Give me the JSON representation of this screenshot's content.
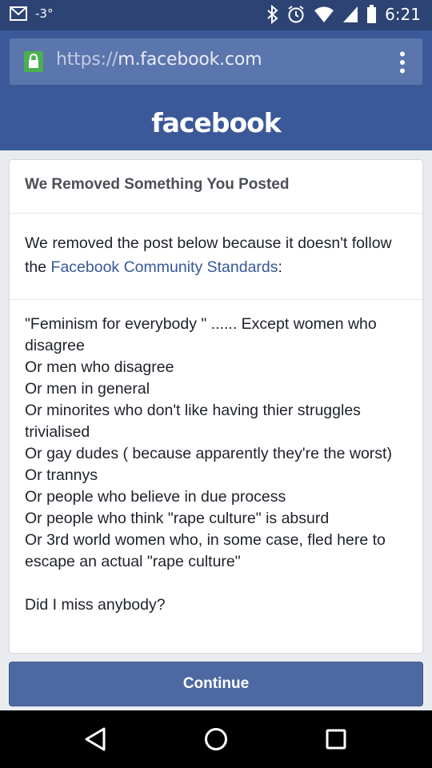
{
  "status_bar": {
    "temperature": "-3°",
    "time": "6:21",
    "icons": [
      "gmail-icon",
      "bluetooth-icon",
      "alarm-icon",
      "wifi-icon",
      "signal-icon",
      "battery-icon"
    ]
  },
  "browser": {
    "url_scheme": "https://",
    "url_host": "m.facebook.com",
    "icons": [
      "lock-icon",
      "overflow-menu-icon"
    ]
  },
  "header": {
    "logo_text": "facebook"
  },
  "card": {
    "title": "We Removed Something You Posted",
    "intro_text": "We removed the post below because it doesn't follow the ",
    "intro_link": "Facebook Community Standards",
    "intro_suffix": ":",
    "post_lines": [
      "\"Feminism for everybody \" ...... Except women who disagree",
      "Or men who disagree",
      "Or men in general",
      "Or minorites who don't like having thier struggles trivialised",
      "Or gay dudes ( because apparently they're the worst)",
      "Or trannys",
      "Or people who believe in due process",
      "Or people who think \"rape culture\" is absurd",
      "Or 3rd world women who, in some case, fled here to escape an actual \"rape culture\""
    ],
    "post_closing": "Did I miss anybody?"
  },
  "actions": {
    "continue_label": "Continue"
  },
  "nav": {
    "icons": [
      "back-icon",
      "home-icon",
      "recents-icon"
    ]
  },
  "colors": {
    "brand": "#3b5998",
    "status_bar": "#2d4373",
    "link": "#365899",
    "button": "#4e69a2",
    "lock_green": "#4caf50"
  }
}
